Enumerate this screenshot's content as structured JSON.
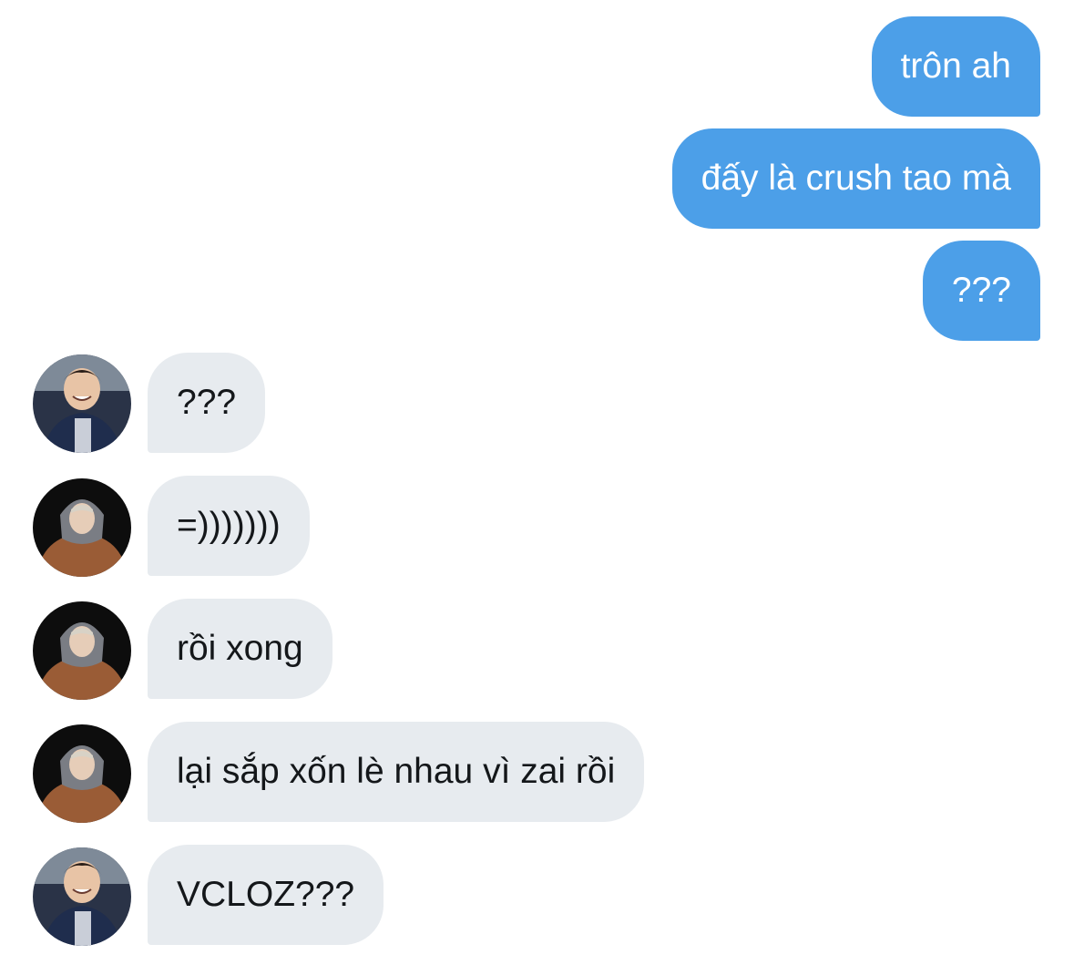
{
  "conversation": {
    "messages": [
      {
        "sender": "me",
        "text": "trôn ah"
      },
      {
        "sender": "me",
        "text": "đấy là crush tao mà"
      },
      {
        "sender": "me",
        "text": "???"
      },
      {
        "sender": "friend-a",
        "text": "???"
      },
      {
        "sender": "friend-b",
        "text": "=)))))))"
      },
      {
        "sender": "friend-b",
        "text": "rồi xong"
      },
      {
        "sender": "friend-b",
        "text": "lại sắp xốn lè nhau vì zai rồi"
      },
      {
        "sender": "friend-a",
        "text": "VCLOZ???"
      }
    ]
  },
  "colors": {
    "sent_bubble": "#4c9fe8",
    "received_bubble": "#e7ebef",
    "sent_text": "#ffffff",
    "received_text": "#14171a"
  }
}
